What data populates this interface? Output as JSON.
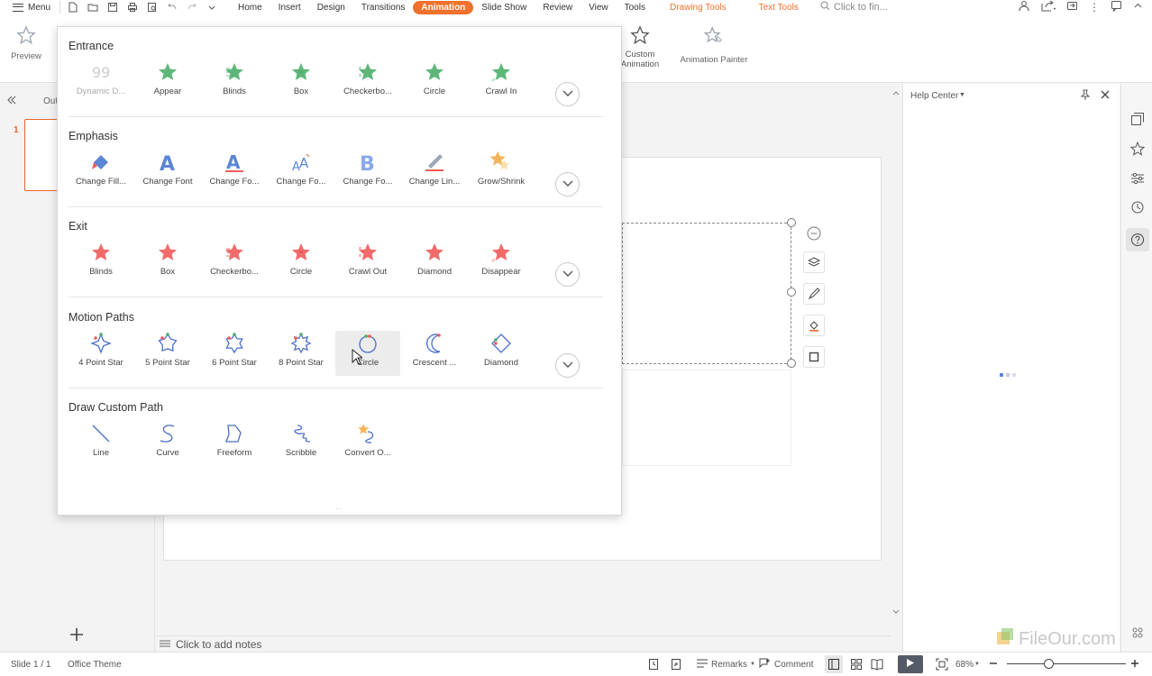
{
  "menubar": {
    "menu_label": "Menu",
    "tabs": [
      "Home",
      "Insert",
      "Design",
      "Transitions",
      "Animation",
      "Slide Show",
      "Review",
      "View",
      "Tools"
    ],
    "active_tab": "Animation",
    "context_tabs": [
      "Drawing Tools",
      "Text Tools"
    ],
    "search_placeholder": "Click to fin..."
  },
  "ribbon": {
    "preview_label": "Preview",
    "custom_animation_label": "Custom Animation",
    "animation_painter_label": "Animation Painter"
  },
  "left_pane": {
    "tab_label": "Out",
    "slide_number": "1"
  },
  "help_pane": {
    "title": "Help Center"
  },
  "notes": {
    "placeholder": "Click to add notes"
  },
  "status": {
    "slide_info": "Slide 1 / 1",
    "theme": "Office Theme",
    "remarks_label": "Remarks",
    "comment_label": "Comment",
    "zoom": "68%",
    "zoom_level": 0.68
  },
  "watermark": "FileOur.com",
  "colors": {
    "accent": "#f0712c",
    "entrance": "#4caf6a",
    "emphasis": "#5b86d6",
    "exit": "#ef5b5b",
    "path": "#4a6fc9"
  },
  "animation_menu": {
    "sections": [
      {
        "title": "Entrance",
        "items": [
          {
            "label": "Dynamic D...",
            "icon": "numbers-icon",
            "dim": true
          },
          {
            "label": "Appear",
            "icon": "star-icon"
          },
          {
            "label": "Blinds",
            "icon": "star-icon"
          },
          {
            "label": "Box",
            "icon": "star-icon"
          },
          {
            "label": "Checkerbo...",
            "icon": "star-icon"
          },
          {
            "label": "Circle",
            "icon": "star-icon"
          },
          {
            "label": "Crawl In",
            "icon": "star-icon"
          }
        ]
      },
      {
        "title": "Emphasis",
        "items": [
          {
            "label": "Change Fill...",
            "icon": "fill-bucket-icon"
          },
          {
            "label": "Change Font",
            "icon": "font-a-icon"
          },
          {
            "label": "Change Fo...",
            "icon": "font-a-underline-icon"
          },
          {
            "label": "Change Fo...",
            "icon": "font-size-icon"
          },
          {
            "label": "Change Fo...",
            "icon": "font-bold-icon"
          },
          {
            "label": "Change Lin...",
            "icon": "line-color-icon"
          },
          {
            "label": "Grow/Shrink",
            "icon": "grow-star-icon"
          }
        ]
      },
      {
        "title": "Exit",
        "items": [
          {
            "label": "Blinds",
            "icon": "star-icon"
          },
          {
            "label": "Box",
            "icon": "star-icon"
          },
          {
            "label": "Checkerbo...",
            "icon": "star-icon"
          },
          {
            "label": "Circle",
            "icon": "star-icon"
          },
          {
            "label": "Crawl Out",
            "icon": "star-icon"
          },
          {
            "label": "Diamond",
            "icon": "star-icon"
          },
          {
            "label": "Disappear",
            "icon": "star-icon"
          }
        ]
      },
      {
        "title": "Motion Paths",
        "items": [
          {
            "label": "4 Point Star",
            "icon": "four-point-star-path-icon"
          },
          {
            "label": "5 Point Star",
            "icon": "five-point-star-path-icon"
          },
          {
            "label": "6 Point Star",
            "icon": "six-point-star-path-icon"
          },
          {
            "label": "8 Point Star",
            "icon": "eight-point-star-path-icon"
          },
          {
            "label": "Circle",
            "icon": "circle-path-icon"
          },
          {
            "label": "Crescent ...",
            "icon": "crescent-path-icon"
          },
          {
            "label": "Diamond",
            "icon": "diamond-path-icon"
          }
        ]
      },
      {
        "title": "Draw Custom Path",
        "items": [
          {
            "label": "Line",
            "icon": "line-path-icon"
          },
          {
            "label": "Curve",
            "icon": "curve-path-icon"
          },
          {
            "label": "Freeform",
            "icon": "freeform-path-icon"
          },
          {
            "label": "Scribble",
            "icon": "scribble-path-icon"
          },
          {
            "label": "Convert O...",
            "icon": "convert-path-icon"
          }
        ]
      }
    ]
  }
}
